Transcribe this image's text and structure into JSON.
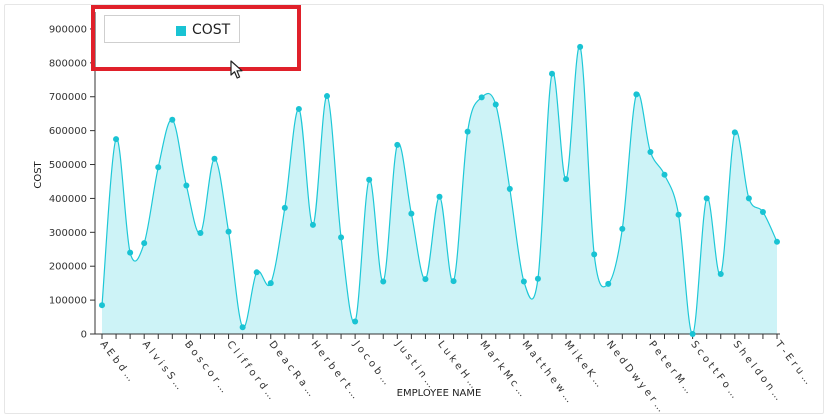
{
  "colors": {
    "line": "#1ec8d7",
    "area": "#cdf3f7",
    "point": "#19c3d3",
    "legend_swatch": "#19c3d3",
    "highlight": "#e0202a"
  },
  "chart_data": {
    "type": "area",
    "xlabel": "EMPLOYEE NAME",
    "ylabel": "COST",
    "ylim": [
      0,
      950000
    ],
    "yticks": [
      0,
      100000,
      200000,
      300000,
      400000,
      500000,
      600000,
      700000,
      800000,
      900000
    ],
    "ytick_labels": [
      "0",
      "100000",
      "200000",
      "300000",
      "400000",
      "500000",
      "600000",
      "700000",
      "800000",
      "900000"
    ],
    "grid": false,
    "legend": {
      "position": "top-left",
      "entries": [
        "COST"
      ]
    },
    "x_labels_visible": [
      "A E b d ...",
      "A l v i s S ...",
      "B o s c o r ...",
      "C l i f f o r d ...",
      "D e a c R a ...",
      "H e r b e r t ...",
      "J o c o b ...",
      "J u s t i n ...",
      "L u k e H ...",
      "M a r k M c ...",
      "M a t t h e w ...",
      "M i k e K ...",
      "N e d D w y e r ...",
      "P e t e r M ...",
      "S c o t t F o ...",
      "S h e l d o n ...",
      "T - E r u ..."
    ],
    "series": [
      {
        "name": "COST",
        "values": [
          85000,
          575000,
          240000,
          268000,
          492000,
          632000,
          438000,
          298000,
          517000,
          302000,
          20000,
          182000,
          150000,
          372000,
          664000,
          322000,
          702000,
          285000,
          37000,
          455000,
          155000,
          558000,
          355000,
          162000,
          405000,
          156000,
          597000,
          698000,
          677000,
          428000,
          155000,
          163000,
          768000,
          457000,
          847000,
          235000,
          148000,
          310000,
          707000,
          537000,
          470000,
          352000,
          0,
          400000,
          177000,
          595000,
          400000,
          360000,
          272000
        ]
      }
    ]
  }
}
